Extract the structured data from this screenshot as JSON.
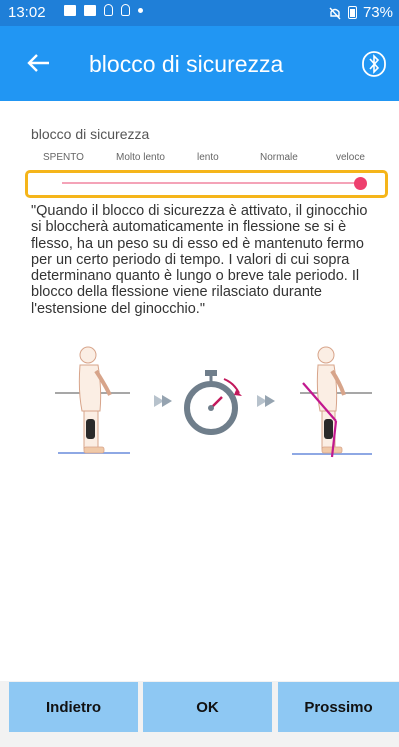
{
  "status_bar": {
    "time": "13:02",
    "battery": "73%",
    "icons": [
      "image-icon",
      "message-icon",
      "bulb-icon",
      "bulb-icon",
      "dot-icon",
      "mute-icon",
      "battery-icon"
    ]
  },
  "app_bar": {
    "title": "blocco di sicurezza",
    "back_icon": "arrow-left-icon",
    "action_icon": "bluetooth-icon"
  },
  "settings": {
    "label": "blocco di sicurezza",
    "levels": [
      "SPENTO",
      "Molto lento",
      "lento",
      "Normale",
      "veloce"
    ],
    "selected_level": "veloce",
    "slider_value": 1.0,
    "highlight_color": "#f5b51a",
    "accent_color": "#ee3f6e"
  },
  "description": "\"Quando il blocco di sicurezza è attivato, il ginocchio si bloccherà automaticamente in flessione se si è flesso, ha un peso su di esso ed è mantenuto fermo per un certo periodo di tempo. I valori di cui sopra determinano quanto è lungo o breve tale periodo. Il blocco della flessione viene rilasciato durante l'estensione del ginocchio.\"",
  "footer": {
    "back_label": "Indietro",
    "ok_label": "OK",
    "next_label": "Prossimo"
  },
  "colors": {
    "status_bar": "#1f7fd8",
    "app_bar": "#2196f3",
    "button": "#8ec8f3"
  }
}
